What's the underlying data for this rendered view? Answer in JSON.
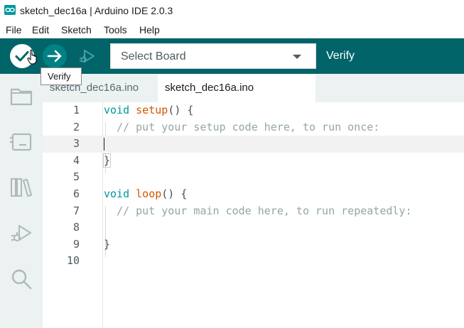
{
  "window": {
    "title": "sketch_dec16a | Arduino IDE 2.0.3"
  },
  "menu": {
    "items": [
      "File",
      "Edit",
      "Sketch",
      "Tools",
      "Help"
    ]
  },
  "toolbar": {
    "verify_icon": "checkmark-icon",
    "upload_icon": "arrow-right-icon",
    "debug_icon": "debug-icon",
    "board_select": {
      "value": "Select Board"
    },
    "status_label": "Verify",
    "tooltip": "Verify"
  },
  "sidebar": {
    "items": [
      {
        "icon": "folder-icon",
        "label": "Sketchbook"
      },
      {
        "icon": "board-icon",
        "label": "Boards Manager"
      },
      {
        "icon": "library-icon",
        "label": "Library Manager"
      },
      {
        "icon": "debug-icon",
        "label": "Debug"
      },
      {
        "icon": "search-icon",
        "label": "Search"
      }
    ]
  },
  "tabs": [
    {
      "label": "sketch_dec16a.ino",
      "active": false
    },
    {
      "label": "sketch_dec16a.ino",
      "active": true
    }
  ],
  "editor": {
    "current_line": 3,
    "lines": [
      {
        "number": "1",
        "kw": "void",
        "fn": "setup",
        "rest": "() {",
        "comment": ""
      },
      {
        "number": "2",
        "kw": "",
        "fn": "",
        "rest": "  ",
        "comment": "// put your setup code here, to run once:"
      },
      {
        "number": "3",
        "kw": "",
        "fn": "",
        "rest": "",
        "comment": ""
      },
      {
        "number": "4",
        "kw": "",
        "fn": "",
        "rest": "}",
        "comment": ""
      },
      {
        "number": "5",
        "kw": "",
        "fn": "",
        "rest": "",
        "comment": ""
      },
      {
        "number": "6",
        "kw": "void",
        "fn": "loop",
        "rest": "() {",
        "comment": ""
      },
      {
        "number": "7",
        "kw": "",
        "fn": "",
        "rest": "  ",
        "comment": "// put your main code here, to run repeatedly:"
      },
      {
        "number": "8",
        "kw": "",
        "fn": "",
        "rest": "",
        "comment": ""
      },
      {
        "number": "9",
        "kw": "",
        "fn": "",
        "rest": "}",
        "comment": ""
      },
      {
        "number": "10",
        "kw": "",
        "fn": "",
        "rest": "",
        "comment": ""
      }
    ]
  },
  "colors": {
    "toolbar": "#006468",
    "accent": "#00979d",
    "sidebar": "#ecf1f1"
  }
}
